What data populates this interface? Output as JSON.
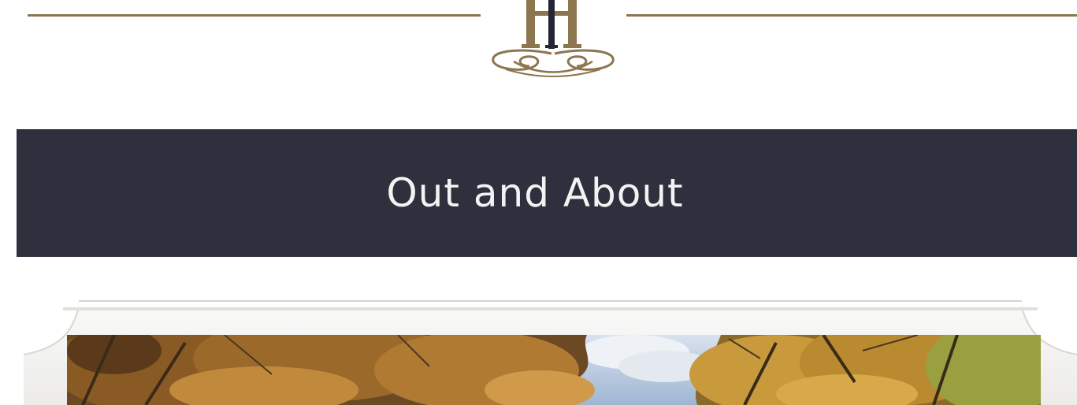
{
  "header": {
    "logo_icon": "hh-monogram-icon",
    "logo_color": "#8b7650",
    "logo_accent_color": "#242635"
  },
  "banner": {
    "title": "Out and About",
    "background_color": "#2f303d",
    "text_color": "#f3f3f3"
  },
  "photo": {
    "frame_color": "#f3f2ef",
    "subject_icon": "autumn-trees-photo"
  }
}
